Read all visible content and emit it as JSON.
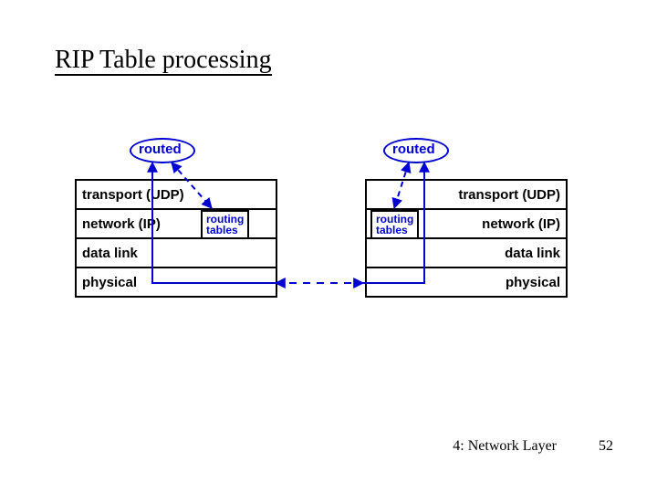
{
  "title": "RIP Table processing",
  "footer": {
    "chapter": "4: Network Layer",
    "page": "52"
  },
  "routed_label": "routed",
  "routing_tables": {
    "line1": "routing",
    "line2": "tables"
  },
  "layers": {
    "transport": "transport (UDP)",
    "network": "network (IP)",
    "datalink": "data link",
    "physical": "physical"
  }
}
